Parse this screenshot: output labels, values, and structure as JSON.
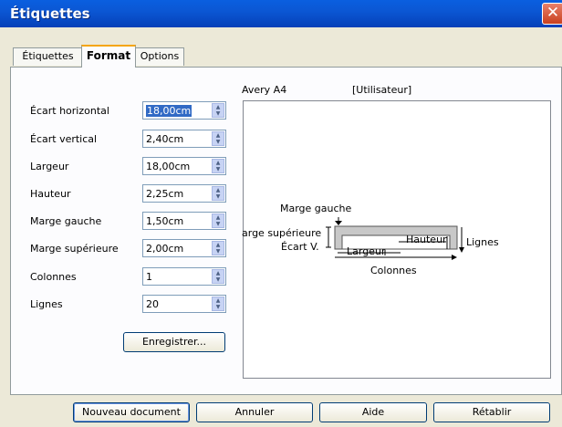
{
  "window": {
    "title": "Étiquettes",
    "close_glyph": "✕"
  },
  "tabs": [
    "Étiquettes",
    "Format",
    "Options"
  ],
  "fields": [
    {
      "label": "Écart horizontal",
      "value": "18,00cm"
    },
    {
      "label": "Écart vertical",
      "value": "2,40cm"
    },
    {
      "label": "Largeur",
      "value": "18,00cm"
    },
    {
      "label": "Hauteur",
      "value": "2,25cm"
    },
    {
      "label": "Marge gauche",
      "value": "1,50cm"
    },
    {
      "label": "Marge supérieure",
      "value": "2,00cm"
    },
    {
      "label": "Colonnes",
      "value": "1"
    },
    {
      "label": "Lignes",
      "value": "20"
    }
  ],
  "save_button": "Enregistrer...",
  "preview": {
    "brand": "Avery A4",
    "type": "[Utilisateur]",
    "labels": {
      "margin_left": "Marge gauche",
      "margin_top": "arge supérieure",
      "gap_v": "Écart V.",
      "height": "Hauteur",
      "width": "Largeur",
      "rows": "Lignes",
      "columns": "Colonnes"
    }
  },
  "buttons": {
    "new_document": "Nouveau document",
    "cancel": "Annuler",
    "help": "Aide",
    "reset": "Rétablir"
  }
}
